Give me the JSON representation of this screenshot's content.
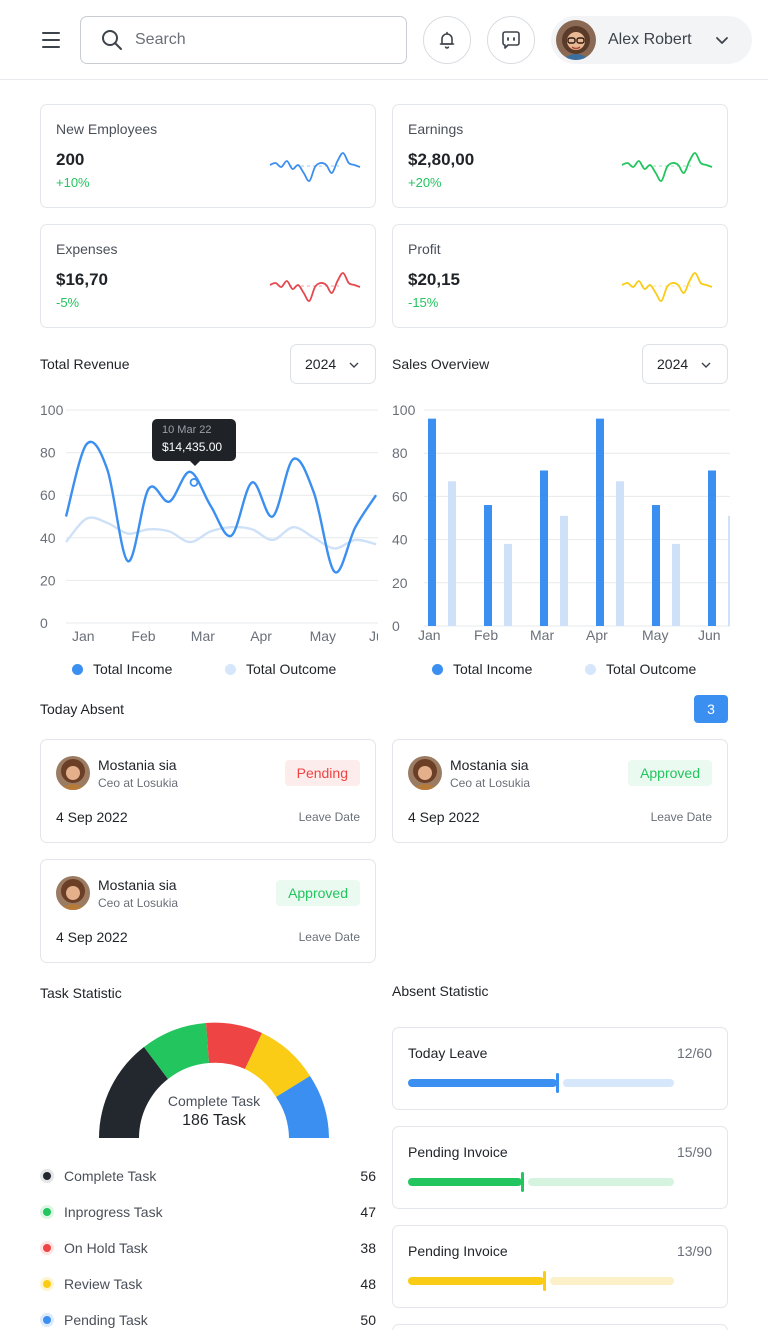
{
  "header": {
    "search_placeholder": "Search",
    "user_name": "Alex Robert"
  },
  "stats": [
    {
      "title": "New Employees",
      "value": "200",
      "change": "+10%",
      "color": "#3b8ff0"
    },
    {
      "title": "Earnings",
      "value": "$2,80,00",
      "change": "+20%",
      "color": "#22c55e"
    },
    {
      "title": "Expenses",
      "value": "$16,70",
      "change": "-5%",
      "color": "#e5484d"
    },
    {
      "title": "Profit",
      "value": "$20,15",
      "change": "-15%",
      "color": "#facc15"
    }
  ],
  "revenue": {
    "title": "Total Revenue",
    "year": "2024",
    "tooltip_date": "10 Mar 22",
    "tooltip_value": "$14,435.00",
    "legend": [
      "Total Income",
      "Total Outcome"
    ]
  },
  "sales": {
    "title": "Sales Overview",
    "year": "2024",
    "legend": [
      "Total Income",
      "Total Outcome"
    ]
  },
  "chart_data": [
    {
      "type": "line",
      "title": "Total Revenue",
      "x": [
        "Jan",
        "Feb",
        "Mar",
        "Apr",
        "May",
        "Jun"
      ],
      "yticks": [
        0,
        20,
        40,
        60,
        80,
        100
      ],
      "ylim": [
        0,
        100
      ],
      "series": [
        {
          "name": "Total Income",
          "color": "#3b8ff0",
          "values": [
            50,
            84,
            72,
            29,
            63,
            57,
            71,
            55,
            41,
            66,
            50,
            77,
            61,
            24,
            45,
            60
          ]
        },
        {
          "name": "Total Outcome",
          "color": "#cfe1f8",
          "values": [
            38,
            49,
            47,
            42,
            44,
            43,
            38,
            43,
            45,
            44,
            39,
            45,
            40,
            35,
            39,
            37
          ]
        }
      ]
    },
    {
      "type": "bar",
      "title": "Sales Overview",
      "categories": [
        "Jan",
        "Feb",
        "Mar",
        "Apr",
        "May",
        "Jun"
      ],
      "yticks": [
        0,
        20,
        40,
        60,
        80,
        100
      ],
      "ylim": [
        0,
        100
      ],
      "series": [
        {
          "name": "Total Income",
          "color": "#3b8ff0",
          "values": [
            96,
            56,
            72,
            96,
            56,
            72
          ]
        },
        {
          "name": "Total Outcome",
          "color": "#cfe1f8",
          "values": [
            67,
            38,
            51,
            67,
            38,
            51
          ]
        }
      ]
    }
  ],
  "absent": {
    "title": "Today Absent",
    "count": "3",
    "items": [
      {
        "name": "Mostania sia",
        "role": "Ceo at Losukia",
        "status": "Pending",
        "date": "4 Sep 2022",
        "date_label": "Leave Date"
      },
      {
        "name": "Mostania sia",
        "role": "Ceo at Losukia",
        "status": "Approved",
        "date": "4 Sep 2022",
        "date_label": "Leave Date"
      },
      {
        "name": "Mostania sia",
        "role": "Ceo at Losukia",
        "status": "Approved",
        "date": "4 Sep 2022",
        "date_label": "Leave Date"
      }
    ]
  },
  "tasks": {
    "title": "Task Statistic",
    "center_label": "Complete Task",
    "center_value": "186 Task",
    "items": [
      {
        "label": "Complete Task",
        "count": "56",
        "color": "#23272e"
      },
      {
        "label": "Inprogress Task",
        "count": "47",
        "color": "#22c55e"
      },
      {
        "label": "On Hold Task",
        "count": "38",
        "color": "#ef4444"
      },
      {
        "label": "Review Task",
        "count": "48",
        "color": "#facc15"
      },
      {
        "label": "Pending Task",
        "count": "50",
        "color": "#3b8ff0"
      }
    ]
  },
  "absent_stats": {
    "title": "Absent Statistic",
    "items": [
      {
        "label": "Today Leave",
        "fraction": "12/60",
        "progress": 0.56,
        "color": "#3b8ff0",
        "track": "#d6e7fb"
      },
      {
        "label": "Pending Invoice",
        "fraction": "15/90",
        "progress": 0.43,
        "color": "#22c55e",
        "track": "#d6f3e0"
      },
      {
        "label": "Pending Invoice",
        "fraction": "13/90",
        "progress": 0.51,
        "color": "#facc15",
        "track": "#fcf0c8"
      }
    ]
  }
}
